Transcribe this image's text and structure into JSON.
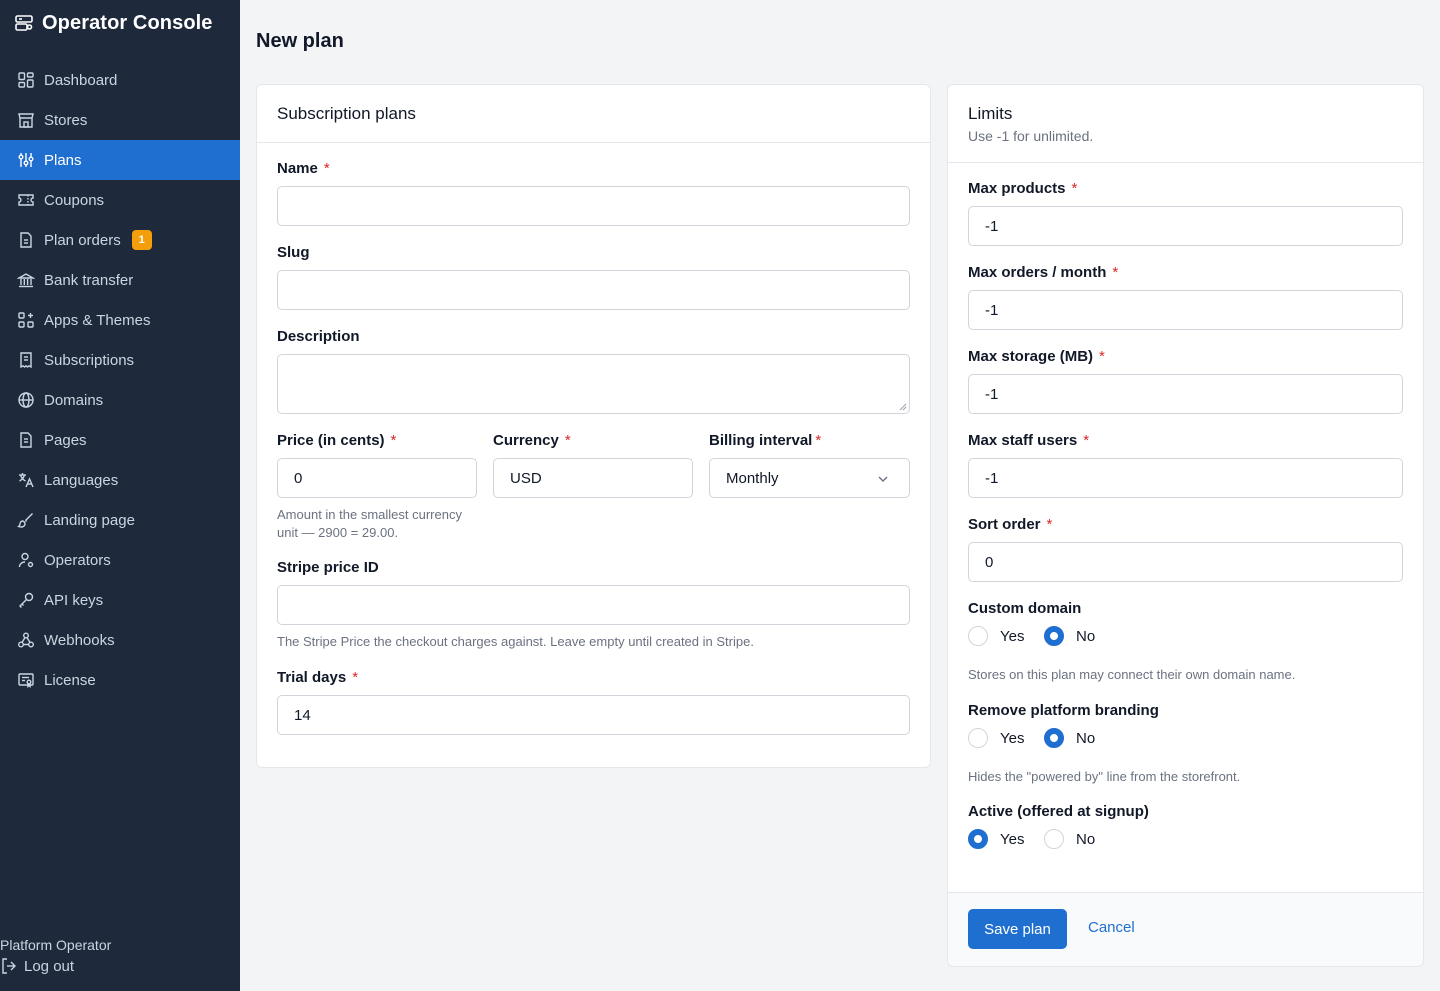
{
  "app": {
    "title": "Operator Console"
  },
  "sidebar": {
    "items": [
      {
        "label": "Dashboard",
        "icon": "dashboard-icon"
      },
      {
        "label": "Stores",
        "icon": "store-icon"
      },
      {
        "label": "Plans",
        "icon": "sliders-icon",
        "active": true
      },
      {
        "label": "Coupons",
        "icon": "ticket-icon"
      },
      {
        "label": "Plan orders",
        "icon": "file-icon",
        "badge": "1"
      },
      {
        "label": "Bank transfer",
        "icon": "bank-icon"
      },
      {
        "label": "Apps & Themes",
        "icon": "apps-icon"
      },
      {
        "label": "Subscriptions",
        "icon": "receipt-icon"
      },
      {
        "label": "Domains",
        "icon": "globe-icon"
      },
      {
        "label": "Pages",
        "icon": "page-icon"
      },
      {
        "label": "Languages",
        "icon": "translate-icon"
      },
      {
        "label": "Landing page",
        "icon": "brush-icon"
      },
      {
        "label": "Operators",
        "icon": "user-cog-icon"
      },
      {
        "label": "API keys",
        "icon": "key-icon"
      },
      {
        "label": "Webhooks",
        "icon": "webhook-icon"
      },
      {
        "label": "License",
        "icon": "certificate-icon"
      }
    ],
    "footer": {
      "user": "Platform Operator",
      "logout": "Log out"
    }
  },
  "page": {
    "title": "New plan"
  },
  "plan_form": {
    "title": "Subscription plans",
    "name": {
      "label": "Name",
      "value": ""
    },
    "slug": {
      "label": "Slug",
      "value": ""
    },
    "description": {
      "label": "Description",
      "value": ""
    },
    "price": {
      "label": "Price (in cents)",
      "value": "0",
      "help": "Amount in the smallest currency unit — 2900 = 29.00."
    },
    "currency": {
      "label": "Currency",
      "value": "USD"
    },
    "interval": {
      "label": "Billing interval",
      "value": "Monthly"
    },
    "stripe": {
      "label": "Stripe price ID",
      "value": "",
      "help": "The Stripe Price the checkout charges against. Leave empty until created in Stripe."
    },
    "trial": {
      "label": "Trial days",
      "value": "14"
    }
  },
  "limits": {
    "title": "Limits",
    "subtitle": "Use -1 for unlimited.",
    "max_products": {
      "label": "Max products",
      "value": "-1"
    },
    "max_orders": {
      "label": "Max orders / month",
      "value": "-1"
    },
    "max_storage": {
      "label": "Max storage (MB)",
      "value": "-1"
    },
    "max_staff": {
      "label": "Max staff users",
      "value": "-1"
    },
    "sort_order": {
      "label": "Sort order",
      "value": "0"
    },
    "custom_domain": {
      "label": "Custom domain",
      "selected": "No",
      "help": "Stores on this plan may connect their own domain name."
    },
    "remove_branding": {
      "label": "Remove platform branding",
      "selected": "No",
      "help": "Hides the \"powered by\" line from the storefront."
    },
    "active": {
      "label": "Active (offered at signup)",
      "selected": "Yes"
    },
    "yes": "Yes",
    "no": "No"
  },
  "actions": {
    "save": "Save plan",
    "cancel": "Cancel"
  },
  "colors": {
    "sidebar": "#1e293b",
    "accent": "#1f6fd0",
    "badge": "#f59e0b",
    "required": "#dc2626"
  }
}
